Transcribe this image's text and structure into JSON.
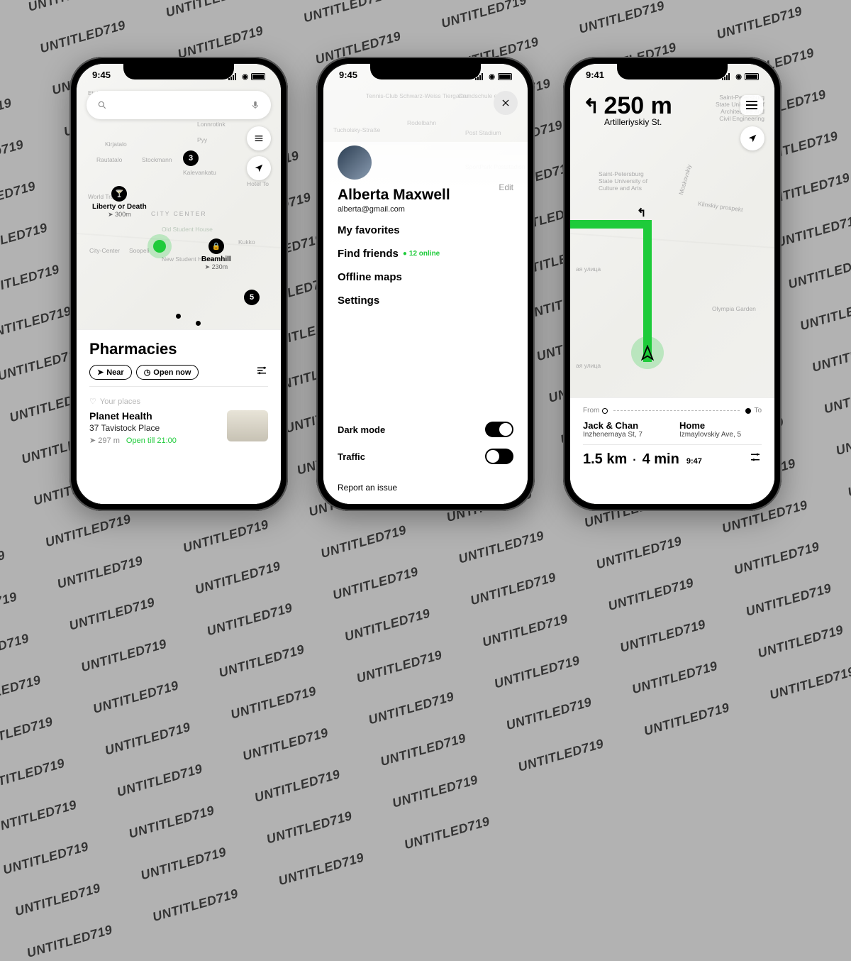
{
  "watermark_text": "UNTITLED719",
  "status": {
    "time": "9:45",
    "time3": "9:41"
  },
  "screen1": {
    "map_labels": [
      "Etelaesplanadi",
      "Lonnrotink",
      "Kirjatalo",
      "Pyy",
      "Rautatalo",
      "Stockmann",
      "Kalevankatu",
      "Hotel To",
      "World Trade",
      "CITY CENTER",
      "Old Student House",
      "Soopeli",
      "City-Center",
      "New Student House",
      "Kukko"
    ],
    "pins": {
      "badge3": "3",
      "badge5": "5"
    },
    "poi1": {
      "name": "Liberty or Death",
      "distance": "300m"
    },
    "poi2": {
      "name": "Beamhill",
      "distance": "230m"
    },
    "sheet": {
      "title": "Pharmacies",
      "pill_near": "Near",
      "pill_open": "Open now",
      "section": "Your places",
      "place": {
        "name": "Planet Health",
        "address": "37 Tavistock Place",
        "distance": "297 m",
        "open": "Open till 21:00"
      }
    }
  },
  "screen2": {
    "map_labels": [
      "Tennis-Club Schwarz-Weiss Tiergarten",
      "Tucholsky-Straße",
      "Grundschule e.V.",
      "Rodelbahn",
      "Post Stadium",
      "SportPark Poststadion"
    ],
    "profile": {
      "name": "Alberta Maxwell",
      "email": "alberta@gmail.com",
      "edit": "Edit"
    },
    "menu": {
      "favorites": "My favorites",
      "find_friends": "Find friends",
      "friends_online": "12 online",
      "offline_maps": "Offline maps",
      "settings": "Settings"
    },
    "toggles": {
      "dark_mode": "Dark mode",
      "traffic": "Traffic"
    },
    "report": "Report an issue"
  },
  "screen3": {
    "nav": {
      "distance": "250 m",
      "street": "Artilleriyskiy St."
    },
    "map_labels_right": [
      "Saint-Petersburg State University of Architecture and Civil Engineering"
    ],
    "map_labels": [
      "Moskovskiy",
      "Klinskiy prospekt",
      "ая улица",
      "Olympia Garden",
      "ая улица",
      "Saint-Petersburg State University of Culture and Arts"
    ],
    "from_label": "From",
    "to_label": "To",
    "from": {
      "name": "Jack & Chan",
      "addr": "Inzhenernaya St, 7"
    },
    "to": {
      "name": "Home",
      "addr": "Izmaylovskiy Ave, 5"
    },
    "summary": {
      "dist": "1.5 km",
      "time": "4 min",
      "eta": "9:47"
    }
  }
}
